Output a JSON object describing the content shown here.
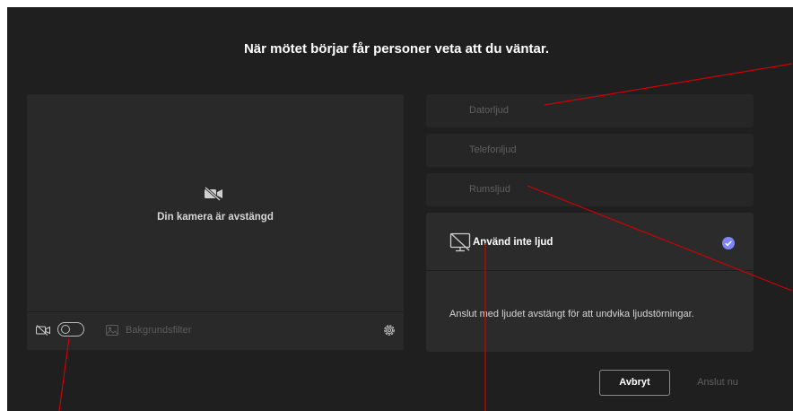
{
  "header": {
    "title": "När mötet börjar får personer veta att du väntar."
  },
  "video_preview": {
    "camera_status": "Din kamera är avstängd",
    "camera_toggle_on": false,
    "background_filter_label": "Bakgrundsfilter"
  },
  "audio_options": [
    {
      "label": "Datorljud"
    },
    {
      "label": "Telefonljud"
    },
    {
      "label": "Rumsljud"
    }
  ],
  "selected_option": {
    "label": "Använd inte ljud",
    "description": "Anslut med ljudet avstängt för att undvika ljudstörningar."
  },
  "footer": {
    "cancel_label": "Avbryt",
    "join_label": "Anslut nu"
  },
  "colors": {
    "background": "#1f1f1f",
    "panel": "#292929",
    "accent": "#7f85f5",
    "annotation": "#d00000"
  },
  "icons": [
    "camera-off-icon",
    "background-filter-icon",
    "gear-icon",
    "no-audio-icon",
    "check-icon"
  ]
}
